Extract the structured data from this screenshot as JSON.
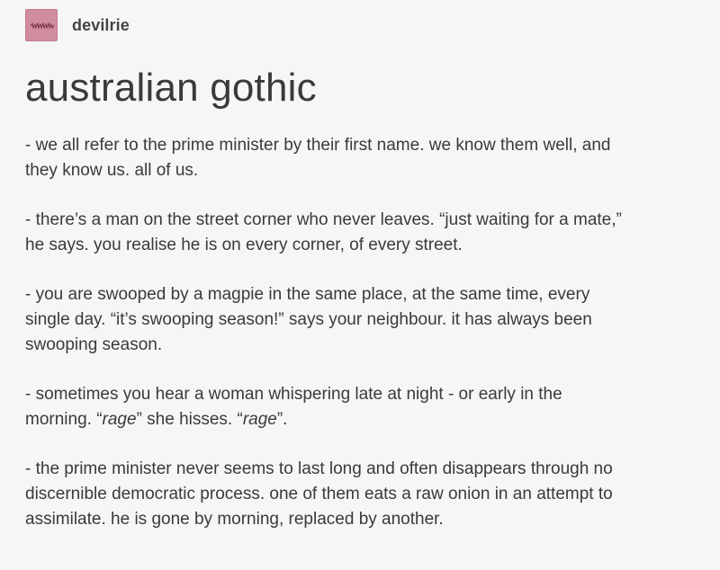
{
  "post": {
    "username": "devilrie",
    "avatar_text": "",
    "title": "australian gothic",
    "paragraphs": [
      {
        "lines": [
          "- we all refer to the prime minister by their first name. we know them well, and",
          "they know us. all of us."
        ]
      },
      {
        "lines": [
          "- there’s a man on the street corner who never leaves. “just waiting for a mate,”",
          "he says. you realise he is on every corner, of every street."
        ]
      },
      {
        "lines": [
          "- you are swooped by a magpie in the same place, at the same time, every",
          "single day. “it’s swooping season!” says your neighbour. it has always been",
          "swooping season."
        ]
      },
      {
        "line1": "- sometimes you hear a woman whispering late at night - or early in the",
        "line2_pre": "morning. “",
        "line2_em1": "rage",
        "line2_mid": "” she hisses. “",
        "line2_em2": "rage",
        "line2_post": "”."
      },
      {
        "lines": [
          "- the prime minister never seems to last long and often disappears through no",
          "discernible democratic process. one of them eats a raw onion in an attempt to",
          "assimilate. he is gone by morning, replaced by another."
        ]
      }
    ]
  },
  "colors": {
    "background": "#f6f6f6",
    "text": "#3a3a3a",
    "avatar": "#cf8d9d"
  }
}
